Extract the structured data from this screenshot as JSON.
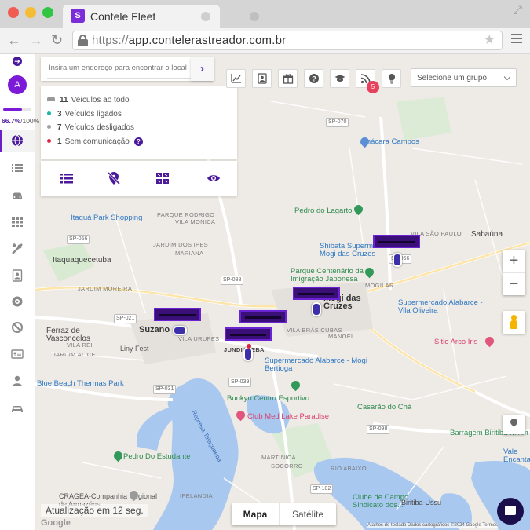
{
  "browser": {
    "tab_title": "Contele Fleet",
    "tab_logo": "S",
    "url_protocol": "https://",
    "url_host": "app.contelerastreador.com.br"
  },
  "sidebar": {
    "avatar_initial": "A",
    "progress_value": "66.7%",
    "progress_total": "/100%",
    "progress_fraction": 0.667,
    "items": [
      {
        "name": "map-globe-icon",
        "active": true
      },
      {
        "name": "list-icon"
      },
      {
        "name": "car-icon"
      },
      {
        "name": "grid-icon"
      },
      {
        "name": "tools-icon"
      },
      {
        "name": "report-icon"
      },
      {
        "name": "target-icon"
      },
      {
        "name": "block-icon"
      },
      {
        "name": "id-card-icon"
      },
      {
        "name": "user-icon"
      },
      {
        "name": "vehicle-icon"
      }
    ]
  },
  "search": {
    "placeholder": "Insira um endereço para encontrar o local",
    "go_icon": "›"
  },
  "status": {
    "total_count": "11",
    "total_label": "Veículos ao todo",
    "on_count": "3",
    "on_label": "Veículos ligados",
    "off_count": "7",
    "off_label": "Veículos desligados",
    "nocomm_count": "1",
    "nocomm_label": "Sem comunicação",
    "help_icon": "?",
    "colors": {
      "on": "#1bb7a6",
      "off": "#a0a0a0",
      "nocomm": "#d9263f",
      "accent": "#4a1a9a"
    }
  },
  "toolbar": {
    "notification_count": "5",
    "group_select_placeholder": "Selecione um grupo"
  },
  "map": {
    "labels": {
      "chacara_campos": "Chácara Campos",
      "pedro_lagarto": "Pedro do Lagarto",
      "itaqua_park": "Itaquá Park Shopping",
      "itaqua": "Itaquaquecetuba",
      "shibata": "Shibata Supermercados - S9 Mogi das Cruzes",
      "sabauna": "Sabaúna",
      "parque_centenario": "Parque Centenário da Imigração Japonesa",
      "mogi": "Mogi das Cruzes",
      "supermercado_alabarce_vila": "Supermercado Alabarce - Vila Oliveira",
      "ferraz": "Ferraz de Vasconcelos",
      "suzano": "Suzano",
      "liny_fest": "Liny Fest",
      "jundiapeba": "JUNDIAPEBA",
      "vila_bras_cubas": "VILA BRÁS CUBAS",
      "mogilar": "MOGILAR",
      "sitio_arco_iris": "Sitio Arco Iris",
      "supermercado_alabarce_bertioga": "Supermercado Alabarce - Mogi Bertioga",
      "blue_beach": "Blue Beach Thermas Park",
      "bunkyo": "Bunkyo Centro Esportivo",
      "club_med": "Club Med Lake Paradise",
      "casarao": "Casarão do Chá",
      "barragem": "Barragem Biritiba-Mirim",
      "represa": "Represa Taiaçupeba",
      "pedro_estudante": "Pedro Do Estudante",
      "cragea": "CRAGEA-Companhia Regional de Armazéns",
      "clube_campo": "Clube de Campo Sindicato dos...",
      "biritiba": "Biritiba-Ussu",
      "vale_encantado": "Vale Encantado",
      "vila_urupes": "VILA URUPES",
      "vila_sao_paulo": "VILA SÃO PAULO",
      "parque_rodrigo": "PARQUE RODRIGO",
      "vila_monica": "VILA MONICA",
      "jardim_dos_ipes": "JARDIM DOS IPES",
      "vila_rei": "VILA REI",
      "socorro": "SOCORRO",
      "mariana": "MARIANA",
      "rio_abaixo": "RIO ABAIXO",
      "martinica": "MARTINICA",
      "ipelandia": "IPELANDIA",
      "jardim_moreira": "JARDIM MOREIRA",
      "manoel": "MANOEL",
      "jardim_alice": "JARDIM ALICE",
      "road_070": "SP-070",
      "road_056": "SP-056",
      "road_088": "SP-088",
      "road_066": "SP-066",
      "road_021": "SP-021",
      "road_039": "SP-039",
      "road_031": "SP-031",
      "road_098": "SP-098",
      "road_102": "SP-102"
    },
    "maptype_map": "Mapa",
    "maptype_satellite": "Satélite",
    "update_text": "Atualização em 12 seg.",
    "google": "Google",
    "attribution": "Atalhos do teclado   Dados cartográficos ©2024 Google   Termos",
    "zoom_in": "+",
    "zoom_out": "−",
    "colors": {
      "water": "#a9c8f0",
      "park": "#c8e6c4",
      "road": "#ffffff",
      "base": "#eeeae5"
    }
  }
}
